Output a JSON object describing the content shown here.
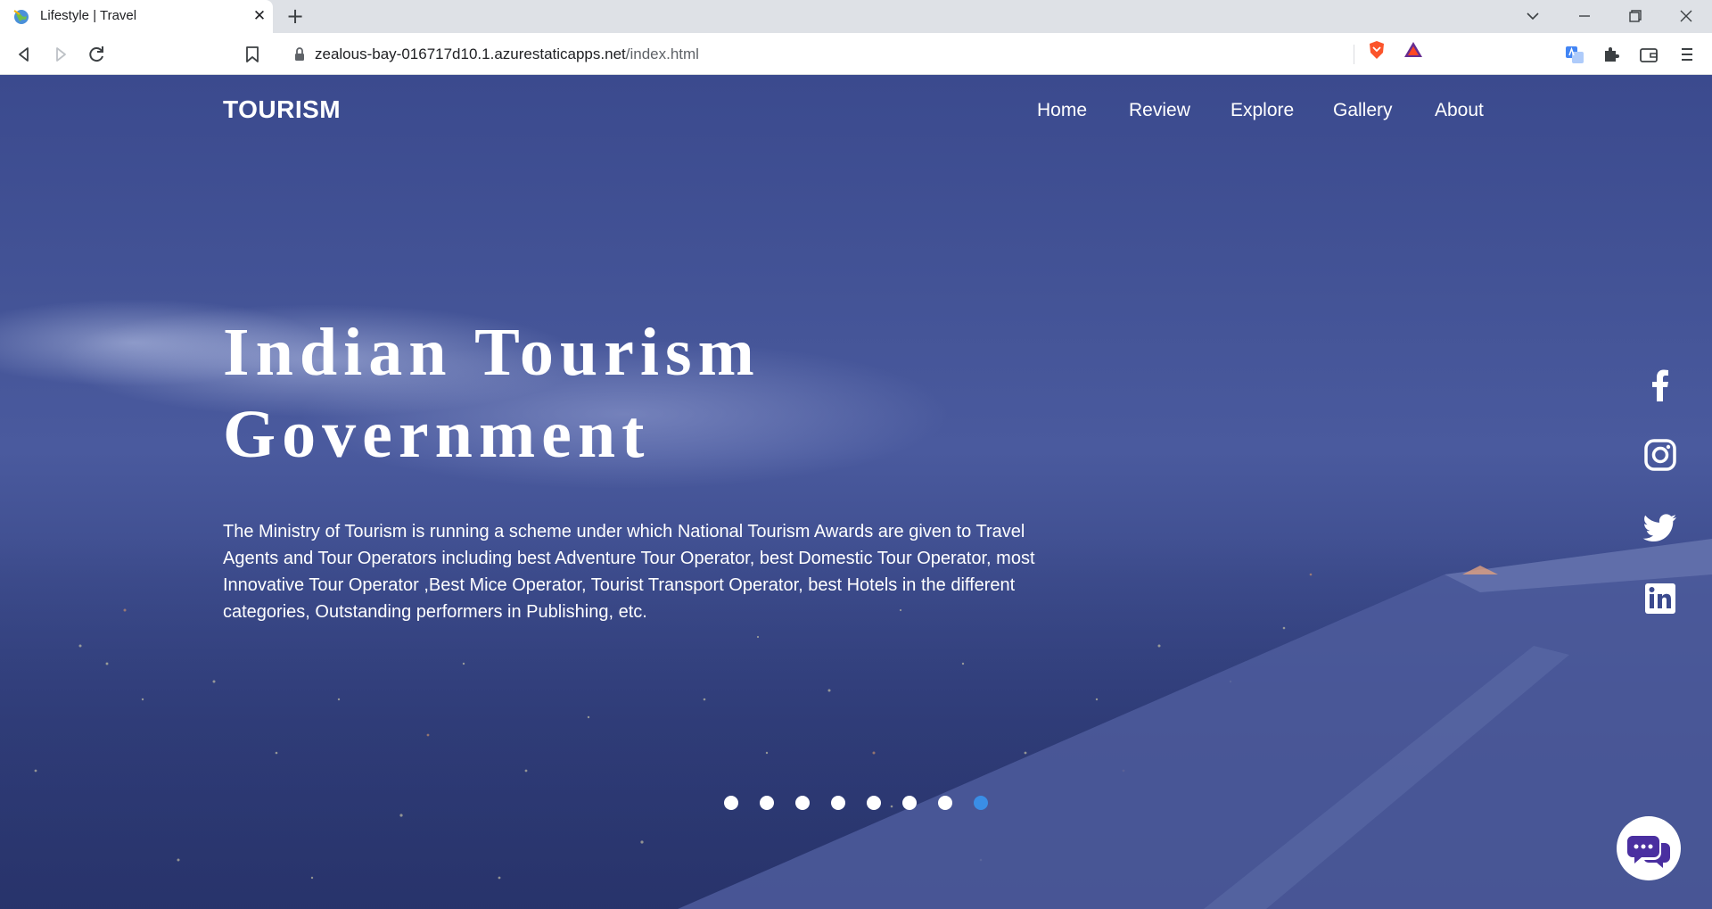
{
  "browser": {
    "tab_title": "Lifestyle | Travel",
    "new_tab": "+",
    "close": "✕",
    "url_host": "zealous-bay-016717d10.1.azurestaticapps.net",
    "url_path": "/index.html"
  },
  "page": {
    "logo": "TOURISM",
    "nav": [
      "Home",
      "Review",
      "Explore",
      "Gallery",
      "About"
    ],
    "hero_title_line1": "Indian Tourism",
    "hero_title_line2": "Government",
    "hero_text": "The Ministry of Tourism is running a scheme under which National Tourism Awards are given to Travel Agents and Tour Operators including best Adventure Tour Operator, best Domestic Tour Operator, most Innovative Tour Operator ,Best Mice Operator, Tourist Transport Operator, best Hotels in the different categories, Outstanding performers in Publishing, etc.",
    "social": [
      "facebook-icon",
      "instagram-icon",
      "twitter-icon",
      "linkedin-icon"
    ],
    "slider": {
      "count": 8,
      "active_index": 7
    },
    "colors": {
      "active_dot": "#3a8ee6",
      "overlay": "#3b4a8e"
    }
  }
}
